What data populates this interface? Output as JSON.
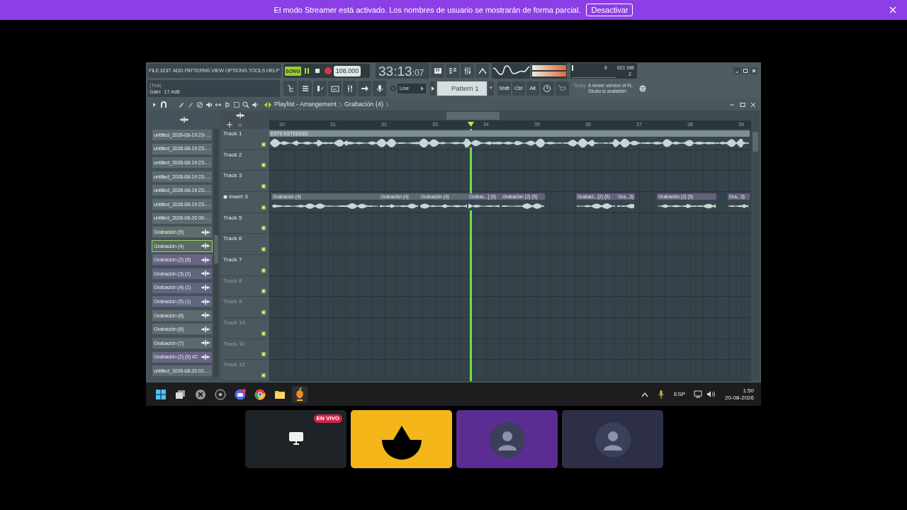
{
  "banner": {
    "message": "El modo Streamer está activado. Los nombres de usuario se mostrarán de forma parcial.",
    "button": "Desactivar"
  },
  "toolbar": {
    "menu": [
      "FILE",
      "EDIT",
      "ADD",
      "PATTERNS",
      "VIEW",
      "OPTIONS",
      "TOOLS",
      "HELP"
    ],
    "mode": "SONG",
    "playing": true,
    "tempo": "108.000",
    "time": "33:13",
    "time_ticks": ":07",
    "cpu": "6",
    "memory": "621 MB",
    "polyphony": "2",
    "hint_title": "(Trial)",
    "hint": "Gain:  17.4dB",
    "snap": "Line",
    "pattern": "Pattern 1",
    "pattern_add": "+",
    "modifiers": [
      "Shift",
      "Ctrl",
      "Alt"
    ],
    "news_time": "Today",
    "news": "A newer version of FL Studio is available!"
  },
  "playlist": {
    "title": "Playlist - Arrangement",
    "crumb": "Grabación (4)",
    "browser": [
      {
        "label": "untitled_2026-08-19 23-…",
        "kind": "pattern",
        "color": "#5d6b70",
        "selected": false
      },
      {
        "label": "untitled_2026-08-19 23-…",
        "kind": "pattern",
        "color": "#5d6b70",
        "selected": false
      },
      {
        "label": "untitled_2026-08-19 23-…",
        "kind": "pattern",
        "color": "#5d6b70",
        "selected": false
      },
      {
        "label": "untitled_2026-08-19 23-…",
        "kind": "pattern",
        "color": "#5d6b70",
        "selected": false
      },
      {
        "label": "untitled_2026-08-19 23-…",
        "kind": "pattern",
        "color": "#5d6b70",
        "selected": false
      },
      {
        "label": "untitled_2026-08-19 23-…",
        "kind": "pattern",
        "color": "#5d6b70",
        "selected": false
      },
      {
        "label": "untitled_2026-08-20 00-…",
        "kind": "pattern",
        "color": "#5d6b70",
        "selected": false
      },
      {
        "label": "Grabación (5)",
        "kind": "audio",
        "color": "#5f6e6c",
        "selected": false
      },
      {
        "label": "Grabación (4)",
        "kind": "audio",
        "color": "#5b6b64",
        "selected": true
      },
      {
        "label": "Grabación (2) (5)",
        "kind": "audio",
        "color": "#6a6385",
        "selected": false
      },
      {
        "label": "Grabación (3) (1)",
        "kind": "audio",
        "color": "#636480",
        "selected": false
      },
      {
        "label": "Grabación (4) (1)",
        "kind": "audio",
        "color": "#636480",
        "selected": false
      },
      {
        "label": "Grabación (5) (1)",
        "kind": "audio",
        "color": "#636480",
        "selected": false
      },
      {
        "label": "Grabación (8)",
        "kind": "audio",
        "color": "#5d6b70",
        "selected": false
      },
      {
        "label": "Grabación (6)",
        "kind": "audio",
        "color": "#5d6b70",
        "selected": false
      },
      {
        "label": "Grabación (7)",
        "kind": "audio",
        "color": "#5d6b70",
        "selected": false
      },
      {
        "label": "Grabación (2) (5) #2",
        "kind": "audio",
        "color": "#6a6385",
        "selected": false
      },
      {
        "label": "untitled_2026-08-20 01-…",
        "kind": "pattern",
        "color": "#5d6b70",
        "selected": false
      }
    ],
    "ruler": [
      "30",
      "31",
      "32",
      "33",
      "34",
      "35",
      "36",
      "37",
      "38",
      "39"
    ],
    "playhead": {
      "level": 0.42
    },
    "tracks": [
      {
        "name": "Track 1",
        "kind": "track",
        "active": true,
        "clips": [
          {
            "label": "ESTE ESTEEEEE",
            "color": "#7c8f93"
          }
        ]
      },
      {
        "name": "Track 2",
        "kind": "track",
        "active": true
      },
      {
        "name": "Track 3",
        "kind": "track",
        "active": true
      },
      {
        "name": "Insert 3",
        "kind": "insert",
        "active": true,
        "clips": [
          {
            "label": "Grabación (4)",
            "color": "#5b6c70"
          },
          {
            "label": "Grabación (4)",
            "color": "#5b6c70"
          },
          {
            "label": "Grabación (4)",
            "color": "#5b6c70"
          },
          {
            "label": "Grabac...] (5)",
            "color": "#665f80"
          },
          {
            "label": "Grabación (2) (5)",
            "color": "#665f80"
          },
          {
            "label": "Grabaci...(2) (5)",
            "color": "#665f80"
          },
          {
            "label": "Gra...3)",
            "color": "#665f80"
          },
          {
            "label": "Grabación (2) (5)",
            "color": "#665f80"
          },
          {
            "label": "Gra...3)",
            "color": "#665f80"
          }
        ]
      },
      {
        "name": "Track 5",
        "kind": "track",
        "active": true
      },
      {
        "name": "Track 6",
        "kind": "track",
        "active": true
      },
      {
        "name": "Track 7",
        "kind": "track",
        "active": true
      },
      {
        "name": "Track 8",
        "kind": "track",
        "active": false
      },
      {
        "name": "Track 9",
        "kind": "track",
        "active": false
      },
      {
        "name": "Track 10",
        "kind": "track",
        "active": false
      },
      {
        "name": "Track 11",
        "kind": "track",
        "active": false
      },
      {
        "name": "Track 12",
        "kind": "track",
        "active": false
      }
    ]
  },
  "taskbar": {
    "language": "ESP",
    "time": "1:50",
    "date": "20-08-2026"
  },
  "tiles": [
    {
      "kind": "screen",
      "color": "#1d2326",
      "badge": "EN VIVO"
    },
    {
      "kind": "logo",
      "color": "#f4b619"
    },
    {
      "kind": "avatar",
      "color": "#5b2c91"
    },
    {
      "kind": "avatar",
      "color": "#2c2f46"
    }
  ]
}
